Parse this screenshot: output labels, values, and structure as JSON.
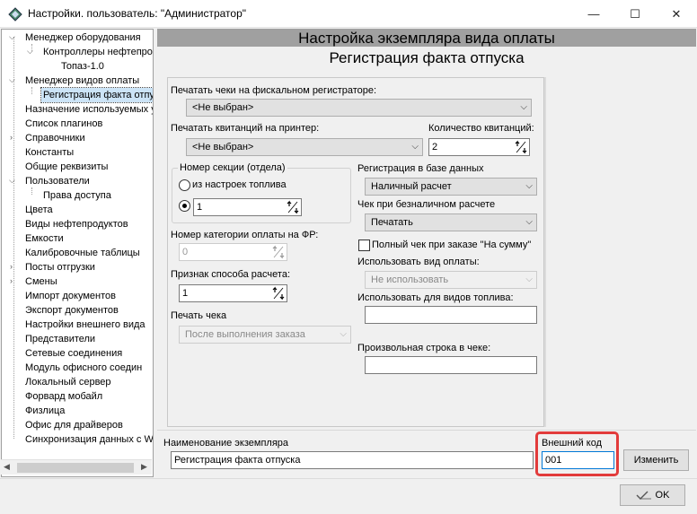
{
  "window": {
    "title": "Настройки. пользователь: \"Администратор\"",
    "minimize_glyph": "—",
    "maximize_glyph": "☐",
    "close_glyph": "✕"
  },
  "tree": {
    "items": [
      {
        "label": "Менеджер оборудования"
      },
      {
        "label": "Контроллеры нефтепро"
      },
      {
        "label": "Топаз-1.0"
      },
      {
        "label": "Менеджер видов оплаты"
      },
      {
        "label": "Регистрация факта отпу"
      },
      {
        "label": "Назначение используемых у"
      },
      {
        "label": "Список плагинов"
      },
      {
        "label": "Справочники"
      },
      {
        "label": "Константы"
      },
      {
        "label": "Общие реквизиты"
      },
      {
        "label": "Пользователи"
      },
      {
        "label": "Права доступа"
      },
      {
        "label": "Цвета"
      },
      {
        "label": "Виды нефтепродуктов"
      },
      {
        "label": "Емкости"
      },
      {
        "label": "Калибровочные таблицы"
      },
      {
        "label": "Посты отгрузки"
      },
      {
        "label": "Смены"
      },
      {
        "label": "Импорт документов"
      },
      {
        "label": "Экспорт документов"
      },
      {
        "label": "Настройки внешнего вида"
      },
      {
        "label": "Представители"
      },
      {
        "label": "Сетевые соединения"
      },
      {
        "label": "Модуль офисного соедин"
      },
      {
        "label": "Локальный сервер"
      },
      {
        "label": "Форвард мобайл"
      },
      {
        "label": "Физлица"
      },
      {
        "label": "Офис для драйверов"
      },
      {
        "label": "Синхронизация данных с W"
      }
    ]
  },
  "header": {
    "line1": "Настройка экземпляра вида оплаты",
    "line2": "Регистрация факта отпуска"
  },
  "form": {
    "print_fiscal_label": "Печатать чеки на фискальном регистраторе:",
    "print_fiscal_value": "<Не выбран>",
    "print_receipts_label": "Печатать квитанций на принтер:",
    "print_receipts_value": "<Не выбран>",
    "receipts_count_label": "Количество квитанций:",
    "receipts_count_value": "2",
    "section_group_label": "Номер секции (отдела)",
    "radio_fuel_label": "из настроек топлива",
    "section_value": "1",
    "fr_category_label": "Номер категории оплаты на ФР:",
    "fr_category_value": "0",
    "calc_method_label": "Признак способа расчета:",
    "calc_method_value": "1",
    "print_check_label": "Печать чека",
    "print_check_value": "После выполнения заказа",
    "db_reg_label": "Регистрация в базе данных",
    "db_reg_value": "Наличный расчет",
    "cashless_label": "Чек при безналичном расчете",
    "cashless_value": "Печатать",
    "full_check_label": "Полный чек при заказе \"На сумму\"",
    "use_payment_label": "Использовать вид оплаты:",
    "use_payment_value": "Не использовать",
    "use_fuel_label": "Использовать для видов топлива:",
    "use_fuel_value": "",
    "custom_line_label": "Произвольная строка в чеке:",
    "custom_line_value": ""
  },
  "bottom": {
    "instance_name_label": "Наименование экземпляра",
    "instance_name_value": "Регистрация факта отпуска",
    "external_code_label": "Внешний код",
    "external_code_value": "001",
    "change_button": "Изменить",
    "ok_button": "OK"
  },
  "colors": {
    "highlight": "#e23b3b",
    "selection": "#cce4f7",
    "header_band": "#a0a0a0"
  }
}
